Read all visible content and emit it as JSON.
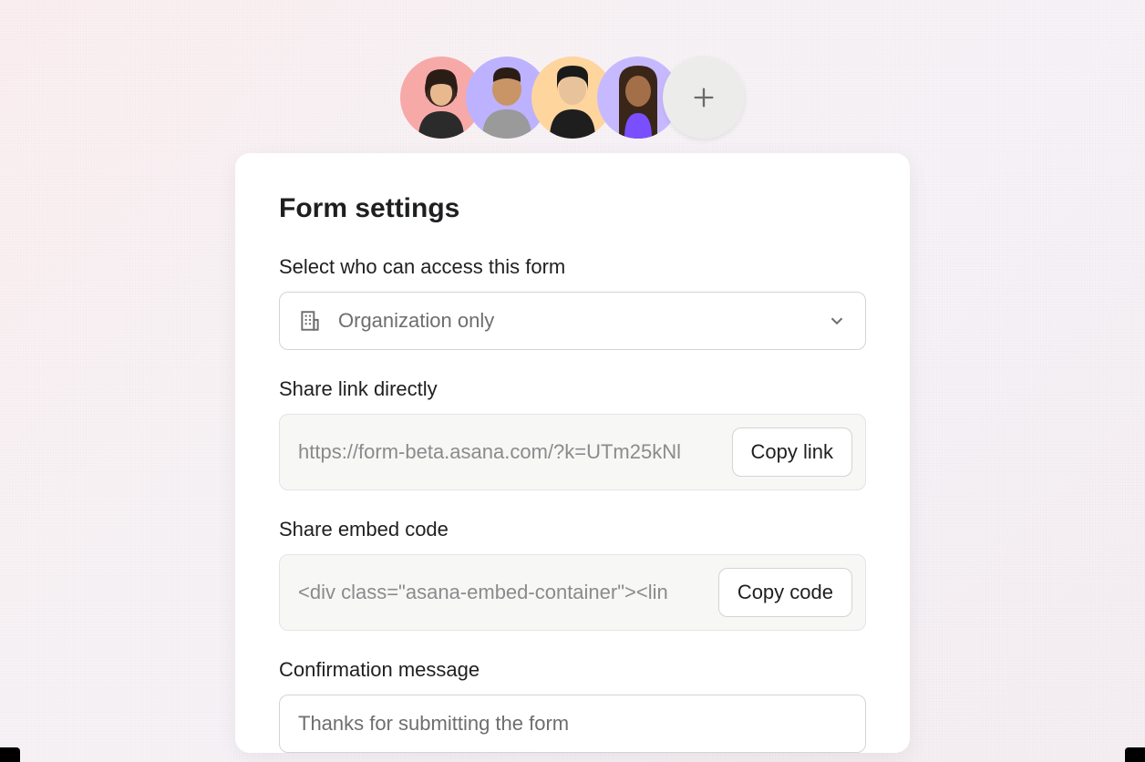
{
  "avatars": {
    "colors": [
      "#f7a9a8",
      "#bdb2ff",
      "#ffd59e",
      "#c7b9ff"
    ],
    "add_icon": "plus-icon"
  },
  "card": {
    "title": "Form settings",
    "access": {
      "label": "Select who can access this form",
      "icon": "building-icon",
      "value": "Organization only"
    },
    "share_link": {
      "label": "Share link directly",
      "value": "https://form-beta.asana.com/?k=UTm25kNl",
      "button": "Copy link"
    },
    "embed_code": {
      "label": "Share embed code",
      "value": "<div class=\"asana-embed-container\"><lin",
      "button": "Copy code"
    },
    "confirmation": {
      "label": "Confirmation message",
      "value": "Thanks for submitting the form"
    }
  }
}
